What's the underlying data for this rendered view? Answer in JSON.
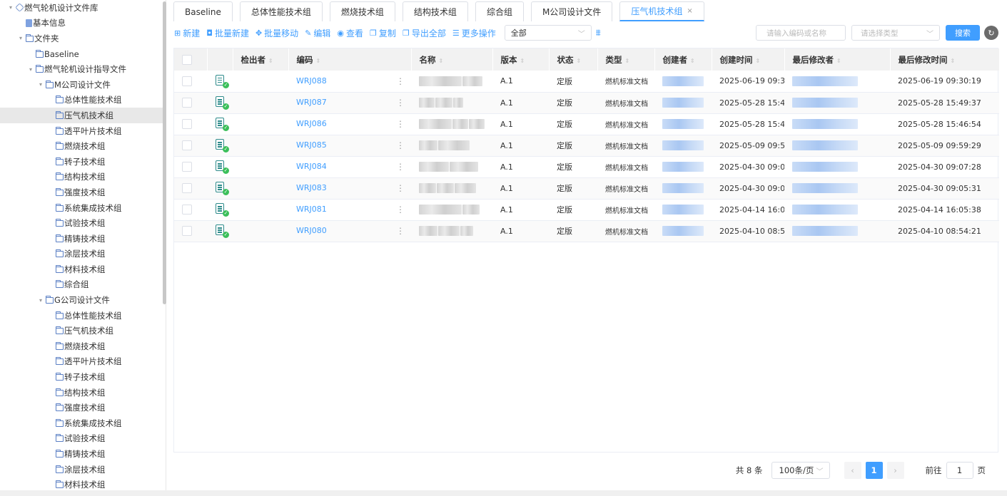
{
  "sidebar": {
    "nodes": [
      {
        "label": "燃气轮机设计文件库",
        "indent": 0,
        "caret": "▾",
        "icon": "cube-icon"
      },
      {
        "label": "基本信息",
        "indent": 1,
        "caret": "",
        "icon": "doc-icon"
      },
      {
        "label": "文件夹",
        "indent": 1,
        "caret": "▾",
        "icon": "folder-icon"
      },
      {
        "label": "Baseline",
        "indent": 2,
        "caret": "",
        "icon": "folder-icon"
      },
      {
        "label": "燃气轮机设计指导文件",
        "indent": 2,
        "caret": "▾",
        "icon": "folder-icon"
      },
      {
        "label": "M公司设计文件",
        "indent": 3,
        "caret": "▾",
        "icon": "folder-icon"
      },
      {
        "label": "总体性能技术组",
        "indent": 4,
        "caret": "",
        "icon": "folder-icon"
      },
      {
        "label": "压气机技术组",
        "indent": 4,
        "caret": "",
        "icon": "folder-icon",
        "selected": true
      },
      {
        "label": "透平叶片技术组",
        "indent": 4,
        "caret": "",
        "icon": "folder-icon"
      },
      {
        "label": "燃烧技术组",
        "indent": 4,
        "caret": "",
        "icon": "folder-icon"
      },
      {
        "label": "转子技术组",
        "indent": 4,
        "caret": "",
        "icon": "folder-icon"
      },
      {
        "label": "结构技术组",
        "indent": 4,
        "caret": "",
        "icon": "folder-icon"
      },
      {
        "label": "强度技术组",
        "indent": 4,
        "caret": "",
        "icon": "folder-icon"
      },
      {
        "label": "系统集成技术组",
        "indent": 4,
        "caret": "",
        "icon": "folder-icon"
      },
      {
        "label": "试验技术组",
        "indent": 4,
        "caret": "",
        "icon": "folder-icon"
      },
      {
        "label": "精铸技术组",
        "indent": 4,
        "caret": "",
        "icon": "folder-icon"
      },
      {
        "label": "涂层技术组",
        "indent": 4,
        "caret": "",
        "icon": "folder-icon"
      },
      {
        "label": "材料技术组",
        "indent": 4,
        "caret": "",
        "icon": "folder-icon"
      },
      {
        "label": "综合组",
        "indent": 4,
        "caret": "",
        "icon": "folder-icon"
      },
      {
        "label": "G公司设计文件",
        "indent": 3,
        "caret": "▾",
        "icon": "folder-icon"
      },
      {
        "label": "总体性能技术组",
        "indent": 4,
        "caret": "",
        "icon": "folder-icon"
      },
      {
        "label": "压气机技术组",
        "indent": 4,
        "caret": "",
        "icon": "folder-icon"
      },
      {
        "label": "燃烧技术组",
        "indent": 4,
        "caret": "",
        "icon": "folder-icon"
      },
      {
        "label": "透平叶片技术组",
        "indent": 4,
        "caret": "",
        "icon": "folder-icon"
      },
      {
        "label": "转子技术组",
        "indent": 4,
        "caret": "",
        "icon": "folder-icon"
      },
      {
        "label": "结构技术组",
        "indent": 4,
        "caret": "",
        "icon": "folder-icon"
      },
      {
        "label": "强度技术组",
        "indent": 4,
        "caret": "",
        "icon": "folder-icon"
      },
      {
        "label": "系统集成技术组",
        "indent": 4,
        "caret": "",
        "icon": "folder-icon"
      },
      {
        "label": "试验技术组",
        "indent": 4,
        "caret": "",
        "icon": "folder-icon"
      },
      {
        "label": "精铸技术组",
        "indent": 4,
        "caret": "",
        "icon": "folder-icon"
      },
      {
        "label": "涂层技术组",
        "indent": 4,
        "caret": "",
        "icon": "folder-icon"
      },
      {
        "label": "材料技术组",
        "indent": 4,
        "caret": "",
        "icon": "folder-icon"
      }
    ]
  },
  "tabs": [
    {
      "label": "Baseline"
    },
    {
      "label": "总体性能技术组"
    },
    {
      "label": "燃烧技术组"
    },
    {
      "label": "结构技术组"
    },
    {
      "label": "综合组"
    },
    {
      "label": "M公司设计文件"
    },
    {
      "label": "压气机技术组",
      "active": true,
      "closable": true
    }
  ],
  "toolbar": {
    "buttons": [
      {
        "label": "新建",
        "glyph": "⊞",
        "name": "new-button"
      },
      {
        "label": "批量新建",
        "glyph": "◘",
        "name": "batch-new-button"
      },
      {
        "label": "批量移动",
        "glyph": "✥",
        "name": "batch-move-button"
      },
      {
        "label": "编辑",
        "glyph": "✎",
        "name": "edit-button"
      },
      {
        "label": "查看",
        "glyph": "◉",
        "name": "view-button"
      },
      {
        "label": "复制",
        "glyph": "❐",
        "name": "copy-button"
      },
      {
        "label": "导出全部",
        "glyph": "❐",
        "name": "export-all-button"
      },
      {
        "label": "更多操作",
        "glyph": "☰",
        "name": "more-actions-button"
      }
    ],
    "scope_value": "全部",
    "search_placeholder": "请输入编码或名称",
    "type_placeholder": "请选择类型",
    "search_label": "搜索"
  },
  "table": {
    "columns": [
      "检出者",
      "编码",
      "名称",
      "版本",
      "状态",
      "类型",
      "创建者",
      "创建时间",
      "最后修改者",
      "最后修改时间"
    ],
    "rows": [
      {
        "code": "WRJ088",
        "version": "A.1",
        "status": "定版",
        "type": "燃机标准文档",
        "created": "2025-06-19 09:3...",
        "modified": "2025-06-19 09:30:19"
      },
      {
        "code": "WRJ087",
        "version": "A.1",
        "status": "定版",
        "type": "燃机标准文档",
        "created": "2025-05-28 15:4...",
        "modified": "2025-05-28 15:49:37"
      },
      {
        "code": "WRJ086",
        "version": "A.1",
        "status": "定版",
        "type": "燃机标准文档",
        "created": "2025-05-28 15:4...",
        "modified": "2025-05-28 15:46:54"
      },
      {
        "code": "WRJ085",
        "version": "A.1",
        "status": "定版",
        "type": "燃机标准文档",
        "created": "2025-05-09 09:5...",
        "modified": "2025-05-09 09:59:29"
      },
      {
        "code": "WRJ084",
        "version": "A.1",
        "status": "定版",
        "type": "燃机标准文档",
        "created": "2025-04-30 09:0...",
        "modified": "2025-04-30 09:07:28"
      },
      {
        "code": "WRJ083",
        "version": "A.1",
        "status": "定版",
        "type": "燃机标准文档",
        "created": "2025-04-30 09:0...",
        "modified": "2025-04-30 09:05:31"
      },
      {
        "code": "WRJ081",
        "version": "A.1",
        "status": "定版",
        "type": "燃机标准文档",
        "created": "2025-04-14 16:0...",
        "modified": "2025-04-14 16:05:38"
      },
      {
        "code": "WRJ080",
        "version": "A.1",
        "status": "定版",
        "type": "燃机标准文档",
        "created": "2025-04-10 08:5...",
        "modified": "2025-04-10 08:54:21"
      }
    ]
  },
  "pagination": {
    "total": "共 8 条",
    "page_size": "100条/页",
    "current_page": "1",
    "goto_prefix": "前往",
    "goto_value": "1",
    "goto_suffix": "页"
  },
  "colors": {
    "accent": "#409eff",
    "selected_row": "#e8e8e8"
  }
}
